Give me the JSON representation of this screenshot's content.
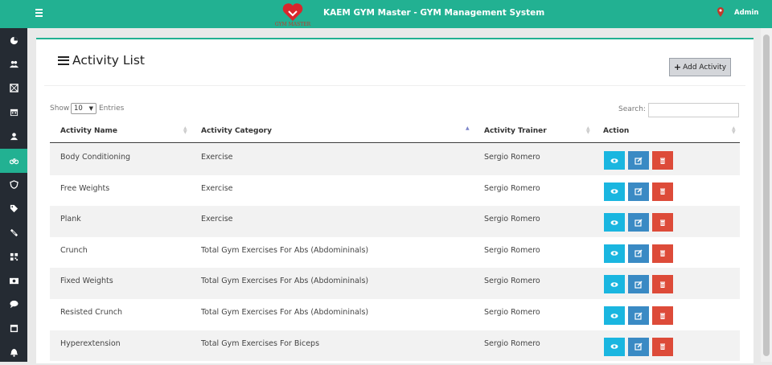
{
  "header": {
    "app_title": "KAEM GYM Master - GYM Management System",
    "logo_text": "GYM MASTER",
    "user_label": "Admin",
    "bar_color": "#22b192"
  },
  "sidebar": {
    "active_index": 5,
    "icons": [
      "dashboard-icon",
      "users-icon",
      "grid-icon",
      "calendar-icon",
      "user-icon",
      "bicycle-icon",
      "shield-icon",
      "tag-icon",
      "ticket-icon",
      "qrcode-icon",
      "money-icon",
      "comment-icon",
      "window-icon",
      "bell-icon"
    ]
  },
  "page": {
    "title": "Activity List",
    "add_button_label": "Add Activity",
    "show_label": "Show",
    "entries_value": "10",
    "entries_label": "Entries",
    "search_label": "Search:",
    "search_value": ""
  },
  "table": {
    "columns": [
      "Activity Name",
      "Activity Category",
      "Activity Trainer",
      "Action"
    ],
    "sorted_column": "Activity Category",
    "rows": [
      {
        "name": "Body Conditioning",
        "category": "Exercise",
        "trainer": "Sergio Romero"
      },
      {
        "name": "Free Weights",
        "category": "Exercise",
        "trainer": "Sergio Romero"
      },
      {
        "name": "Plank",
        "category": "Exercise",
        "trainer": "Sergio Romero"
      },
      {
        "name": "Crunch",
        "category": "Total Gym Exercises For Abs (Abdomininals)",
        "trainer": "Sergio Romero"
      },
      {
        "name": "Fixed Weights",
        "category": "Total Gym Exercises For Abs (Abdomininals)",
        "trainer": "Sergio Romero"
      },
      {
        "name": "Resisted Crunch",
        "category": "Total Gym Exercises For Abs (Abdomininals)",
        "trainer": "Sergio Romero"
      },
      {
        "name": "Hyperextension",
        "category": "Total Gym Exercises For Biceps",
        "trainer": "Sergio Romero"
      }
    ]
  },
  "colors": {
    "accent": "#22b192",
    "sidebar_bg": "#252b33",
    "view_btn": "#1ab6e0",
    "edit_btn": "#3a8ac4",
    "delete_btn": "#dd4b39"
  }
}
